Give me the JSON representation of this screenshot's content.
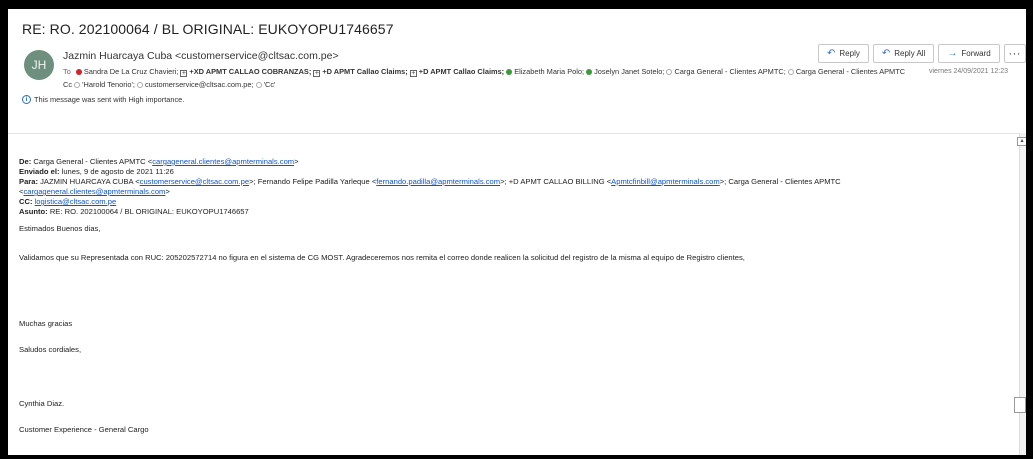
{
  "email": {
    "subject": "RE: RO. 202100064 / BL ORIGINAL: EUKOYOPU1746657",
    "avatar_initials": "JH",
    "sender": "Jazmin Huarcaya Cuba <customerservice@cltsac.com.pe>",
    "to_label": "To",
    "cc_label": "Cc",
    "recipients": [
      {
        "marker": "red",
        "text": "Sandra De La Cruz Chavieri;",
        "bold": false
      },
      {
        "marker": "group",
        "text": "+XD APMT CALLAO COBRANZAS;",
        "bold": true
      },
      {
        "marker": "group",
        "text": "+D APMT Callao Claims;",
        "bold": true
      },
      {
        "marker": "group",
        "text": "+D APMT Callao Claims;",
        "bold": true
      },
      {
        "marker": "green",
        "text": "Elizabeth Maria Polo;",
        "bold": false
      },
      {
        "marker": "green",
        "text": "Joselyn Janet Sotelo;",
        "bold": false
      },
      {
        "marker": "empty",
        "text": "Carga General - Clientes APMTC;",
        "bold": false
      },
      {
        "marker": "empty",
        "text": "Carga General - Clientes APMTC",
        "bold": false
      }
    ],
    "cc": [
      {
        "text": "'Harold Tenorio';"
      },
      {
        "text": "customerservice@cltsac.com.pe;"
      },
      {
        "text": "'Cc'"
      }
    ],
    "importance": "This message was sent with High importance.",
    "date": "viernes 24/09/2021 12:23"
  },
  "toolbar": {
    "reply": "Reply",
    "reply_all": "Reply All",
    "forward": "Forward",
    "more": "···"
  },
  "quoted": {
    "de_label": "De:",
    "de_name": "Carga General - Clientes APMTC <",
    "de_email": "cargageneral.clientes@apmterminals.com",
    "de_end": ">",
    "enviado_label": "Enviado el:",
    "enviado_value": "lunes, 9 de agosto de 2021 11:26",
    "para_label": "Para:",
    "para_1": "JAZMIN HUARCAYA CUBA <",
    "para_1_email": "customerservice@cltsac.com.pe",
    "para_2": ">; Fernando Felipe Padilla Yarleque <",
    "para_2_email": "fernando.padilla@apmterminals.com",
    "para_3": ">; +D APMT CALLAO BILLING <",
    "para_3_email": "Apmtcfinbill@apmterminals.com",
    "para_4": ">; Carga General - Clientes APMTC",
    "para_5": "<",
    "para_5_email": "cargageneral.clientes@apmterminals.com",
    "para_6": ">",
    "cc_label": "CC:",
    "cc_email": "logistica@cltsac.com.pe",
    "asunto_label": "Asunto:",
    "asunto_value": "RE: RO. 202100064 / BL ORIGINAL: EUKOYOPU1746657"
  },
  "body": {
    "greeting": "Estimados Buenos dias,",
    "message": "Validamos que su Representada con RUC: 205202572714 no figura en el sistema de CG MOST. Agradeceremos nos remita el correo donde realicen la solicitud del registro de la misma al equipo de Registro clientes,",
    "thanks": "Muchas gracias",
    "regards": "Saludos cordiales,",
    "signature_name": "Cynthia Diaz.",
    "signature_title": "Customer Experience - General Cargo"
  }
}
